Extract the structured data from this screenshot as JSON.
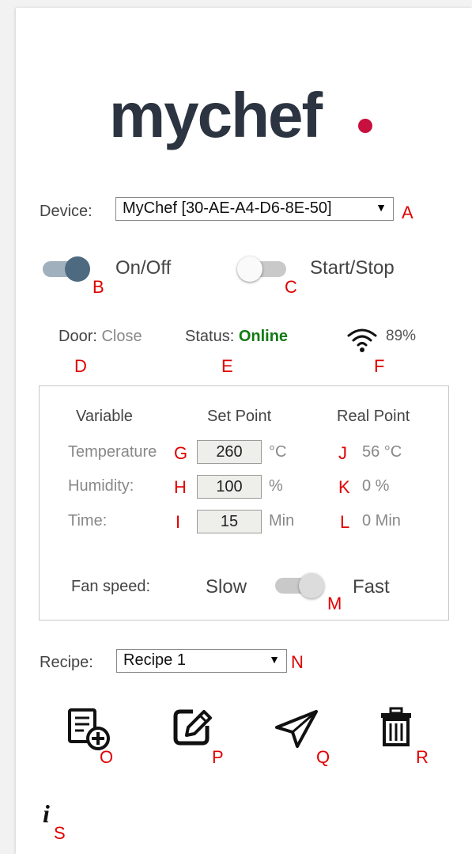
{
  "logo": {
    "text": "mychef",
    "dot_color": "#c8103e"
  },
  "device": {
    "label": "Device:",
    "selected": "MyChef [30-AE-A4-D6-8E-50]",
    "marker": "A"
  },
  "power": {
    "label": "On/Off",
    "state": "on",
    "marker": "B"
  },
  "run": {
    "label": "Start/Stop",
    "state": "off",
    "marker": "C"
  },
  "door": {
    "label": "Door:",
    "value": "Close",
    "marker": "D"
  },
  "status": {
    "label": "Status:",
    "value": "Online",
    "color": "#137a13",
    "marker": "E"
  },
  "wifi": {
    "icon": "wifi-icon",
    "value": "89%",
    "marker": "F"
  },
  "table": {
    "headers": {
      "variable": "Variable",
      "set_point": "Set Point",
      "real_point": "Real Point"
    },
    "rows": [
      {
        "name": "Temperature",
        "set_marker": "G",
        "set_value": "260",
        "set_unit": "°C",
        "real_marker": "J",
        "real_value": "56 °C"
      },
      {
        "name": "Humidity:",
        "set_marker": "H",
        "set_value": "100",
        "set_unit": "%",
        "real_marker": "K",
        "real_value": "0 %"
      },
      {
        "name": "Time:",
        "set_marker": "I",
        "set_value": "15",
        "set_unit": "Min",
        "real_marker": "L",
        "real_value": "0 Min"
      }
    ],
    "fan": {
      "label": "Fan speed:",
      "slow": "Slow",
      "fast": "Fast",
      "state": "fast",
      "marker": "M"
    }
  },
  "recipe": {
    "label": "Recipe:",
    "selected": "Recipe 1",
    "marker": "N"
  },
  "actions": [
    {
      "icon": "add-recipe-icon",
      "marker": "O"
    },
    {
      "icon": "edit-icon",
      "marker": "P"
    },
    {
      "icon": "send-icon",
      "marker": "Q"
    },
    {
      "icon": "trash-icon",
      "marker": "R"
    }
  ],
  "info": {
    "icon": "info-icon",
    "glyph": "i",
    "marker": "S"
  }
}
